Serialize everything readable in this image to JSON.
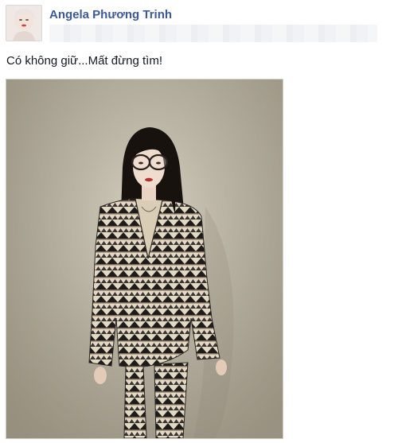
{
  "post": {
    "author_name": "Angela Phương Trinh",
    "status_text": "Có không giữ...Mất đừng tìm!"
  },
  "icons": {
    "avatar": "profile-avatar",
    "photo": "photo-woman-in-patterned-suit"
  },
  "colors": {
    "author_link": "#3b5998",
    "text": "#141823",
    "background": "#ffffff"
  }
}
